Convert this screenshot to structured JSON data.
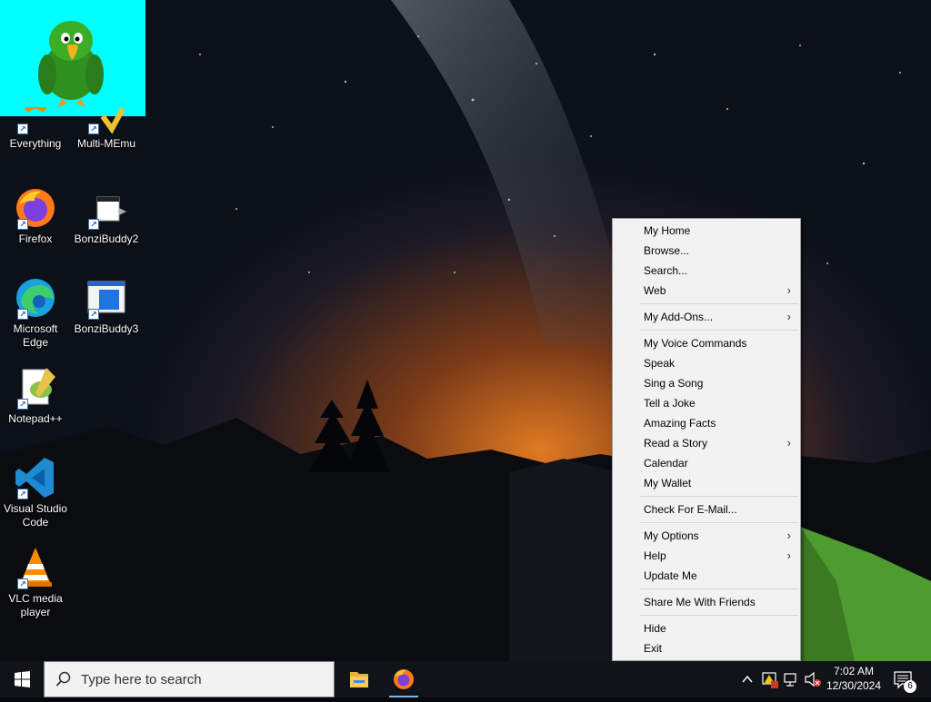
{
  "desktop": {
    "icons": [
      {
        "label": "Everything"
      },
      {
        "label": "Multi-MEmu"
      },
      {
        "label": "Firefox"
      },
      {
        "label": "BonziBuddy2"
      },
      {
        "label": "Microsoft Edge"
      },
      {
        "label": "BonziBuddy3"
      },
      {
        "label": "Notepad++"
      },
      {
        "label": "Visual Studio Code"
      },
      {
        "label": "VLC media player"
      }
    ]
  },
  "context_menu": {
    "groups": [
      [
        {
          "label": "My Home"
        },
        {
          "label": "Browse..."
        },
        {
          "label": "Search..."
        },
        {
          "label": "Web",
          "submenu": true
        }
      ],
      [
        {
          "label": "My Add-Ons...",
          "submenu": true
        }
      ],
      [
        {
          "label": "My Voice Commands"
        },
        {
          "label": "Speak"
        },
        {
          "label": "Sing a Song"
        },
        {
          "label": "Tell a Joke"
        },
        {
          "label": "Amazing Facts"
        },
        {
          "label": "Read a Story",
          "submenu": true
        },
        {
          "label": "Calendar"
        },
        {
          "label": "My Wallet"
        }
      ],
      [
        {
          "label": "Check For E-Mail..."
        }
      ],
      [
        {
          "label": "My Options",
          "submenu": true
        },
        {
          "label": "Help",
          "submenu": true
        },
        {
          "label": "Update Me"
        }
      ],
      [
        {
          "label": "Share Me With Friends"
        }
      ],
      [
        {
          "label": "Hide"
        },
        {
          "label": "Exit"
        }
      ]
    ]
  },
  "taskbar": {
    "search_placeholder": "Type here to search",
    "clock_time": "7:02 AM",
    "clock_date": "12/30/2024",
    "notification_count": "6"
  },
  "colors": {
    "bonzi_background": "#00ffff",
    "taskbar": "#101317",
    "menu_background": "#f2f2f2",
    "accent": "#76b9ed"
  }
}
